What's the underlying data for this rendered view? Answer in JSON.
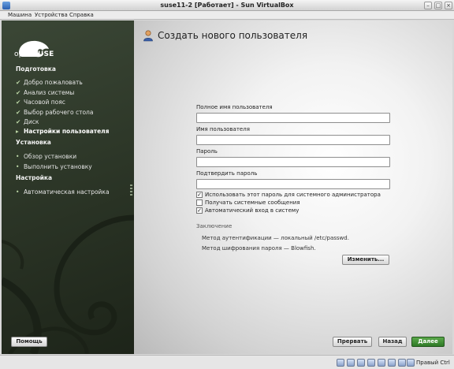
{
  "window": {
    "title": "suse11-2 [Работает] - Sun VirtualBox"
  },
  "menu": [
    "Машина",
    "Устройства",
    "Справка"
  ],
  "logo": {
    "prefix": "open",
    "suffix": "SUSE"
  },
  "sidebar": {
    "sections": [
      {
        "title": "Подготовка",
        "items": [
          {
            "label": "Добро пожаловать",
            "mark": "✔"
          },
          {
            "label": "Анализ системы",
            "mark": "✔"
          },
          {
            "label": "Часовой пояс",
            "mark": "✔"
          },
          {
            "label": "Выбор рабочего стола",
            "mark": "✔"
          },
          {
            "label": "Диск",
            "mark": "✔"
          },
          {
            "label": "Настройки пользователя",
            "mark": "▸",
            "current": true
          }
        ]
      },
      {
        "title": "Установка",
        "items": [
          {
            "label": "Обзор установки",
            "mark": "•"
          },
          {
            "label": "Выполнить установку",
            "mark": "•"
          }
        ]
      },
      {
        "title": "Настройка",
        "items": [
          {
            "label": "Автоматическая настройка",
            "mark": "•"
          }
        ]
      }
    ]
  },
  "page": {
    "title": "Создать нового пользователя",
    "icon": "user-icon",
    "fields": [
      {
        "label": "Полное имя пользователя",
        "value": ""
      },
      {
        "label": "Имя пользователя",
        "value": ""
      },
      {
        "label": "Пароль",
        "value": ""
      },
      {
        "label": "Подтвердить пароль",
        "value": ""
      }
    ],
    "checkboxes": [
      {
        "label": "Использовать этот пароль для системного администратора",
        "checked": true
      },
      {
        "label": "Получать системные сообщения",
        "checked": false
      },
      {
        "label": "Автоматический вход в систему",
        "checked": true
      }
    ],
    "summary": {
      "title": "Заключение",
      "lines": [
        "Метод аутентификации — локальный /etc/passwd.",
        "Метод шифрования пароля — Blowfish."
      ],
      "change_button": "Изменить..."
    }
  },
  "footer": {
    "help": "Помощь",
    "abort": "Прервать",
    "back": "Назад",
    "next": "Далее"
  },
  "statusbar": {
    "host_key": "Правый Ctrl"
  },
  "colors": {
    "next_button": "#3f8f35",
    "sidebar_bg": "#2d3728"
  }
}
